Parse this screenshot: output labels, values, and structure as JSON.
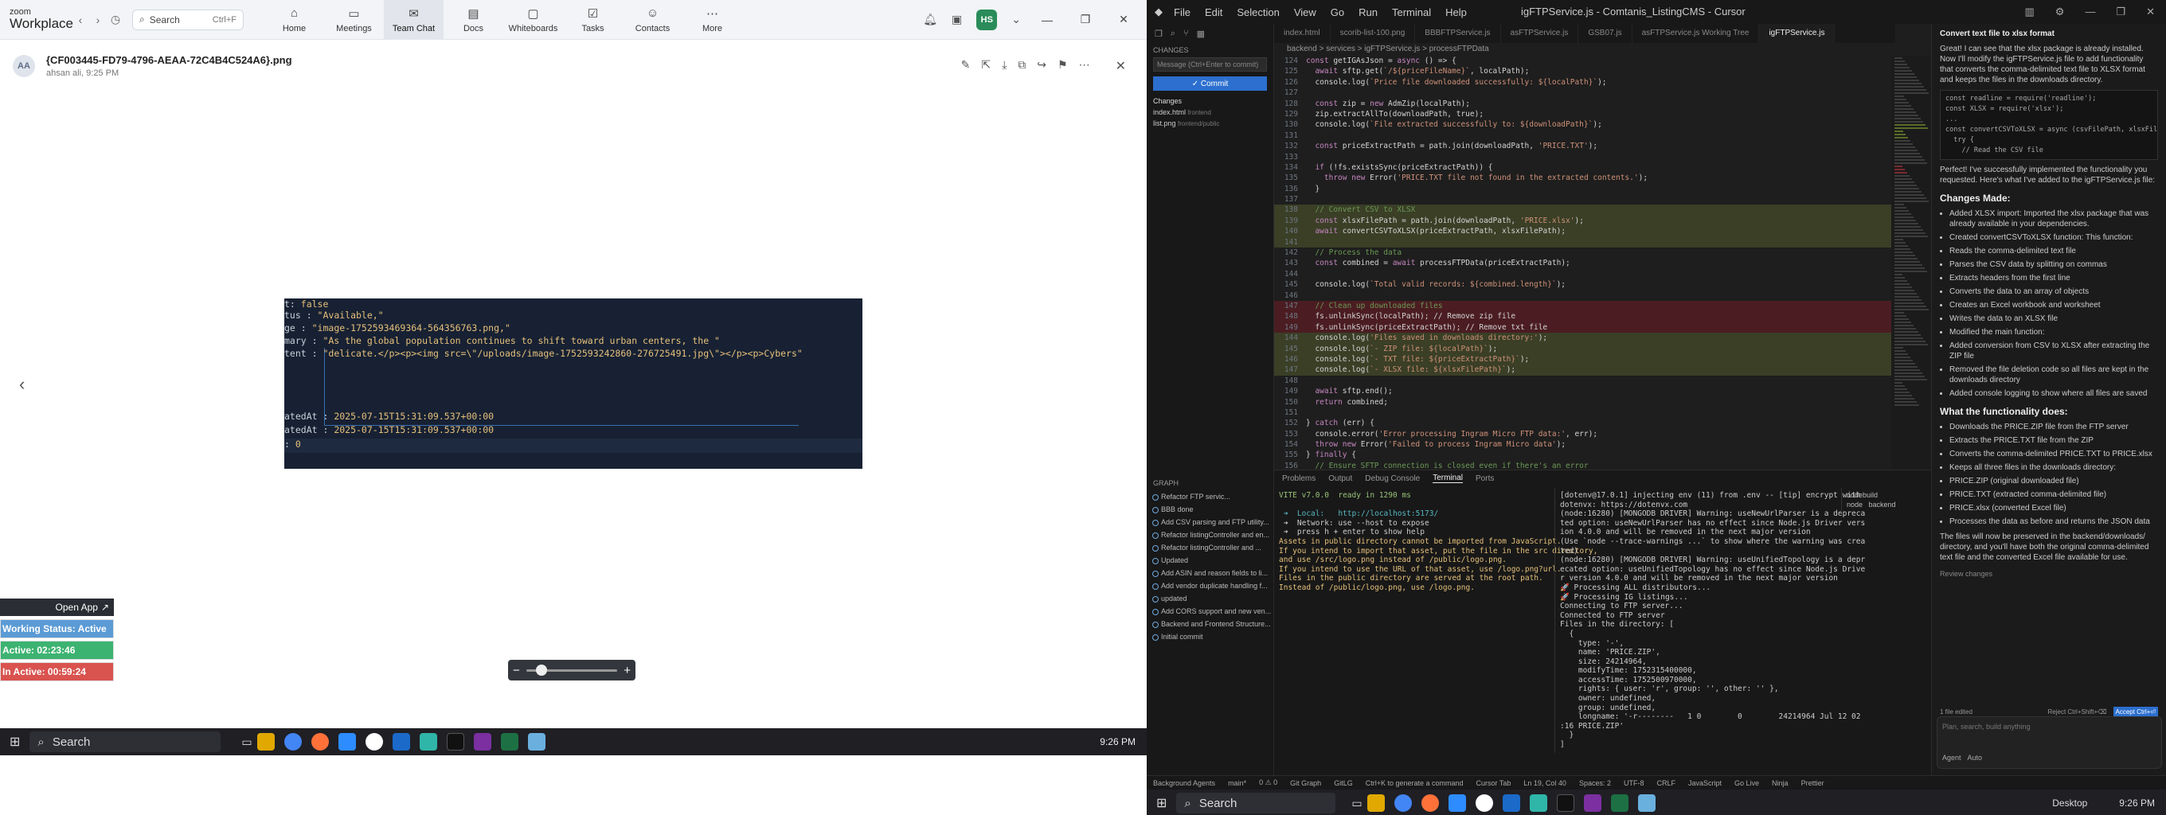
{
  "zoom": {
    "brand_line1": "zoom",
    "brand_line2": "Workplace",
    "search_placeholder": "Search",
    "search_shortcut": "Ctrl+F",
    "nav": [
      {
        "label": "Home",
        "icon": "home-icon",
        "glyph": "⌂"
      },
      {
        "label": "Meetings",
        "icon": "video-icon",
        "glyph": "▭"
      },
      {
        "label": "Team Chat",
        "icon": "chat-icon",
        "glyph": "✉"
      },
      {
        "label": "Docs",
        "icon": "doc-icon",
        "glyph": "▤"
      },
      {
        "label": "Whiteboards",
        "icon": "whiteboard-icon",
        "glyph": "▢"
      },
      {
        "label": "Tasks",
        "icon": "tasks-icon",
        "glyph": "☑"
      },
      {
        "label": "Contacts",
        "icon": "contacts-icon",
        "glyph": "☺"
      },
      {
        "label": "More",
        "icon": "more-icon",
        "glyph": "⋯"
      }
    ],
    "active_tab": "Team Chat",
    "user_initials": "HS",
    "viewer": {
      "avatar_initials": "AA",
      "file_name": "{CF003445-FD79-4796-AEAA-72C4B4C524A6}.png",
      "meta": "ahsan ali, 9:25 PM"
    },
    "screenshot_lines": [
      {
        "key": "t: ",
        "val": "false"
      },
      {
        "key": "tus : ",
        "val": "\"Available,\""
      },
      {
        "key": "ge : ",
        "val": "\"image-1752593469364-564356763.png,\""
      },
      {
        "key": "mary : ",
        "val": "\"As the global population continues to shift toward urban centers, the \""
      },
      {
        "key": "tent : ",
        "val": "\"delicate.</p><p><img src=\\\"/uploads/image-1752593242860-276725491.jpg\\\"></p><p>Cybers\""
      },
      {
        "key": "atedAt : ",
        "val": "2025-07-15T15:31:09.537+00:00"
      },
      {
        "key": "atedAt : ",
        "val": "2025-07-15T15:31:09.537+00:00"
      },
      {
        "key": ": ",
        "val": "0"
      }
    ],
    "open_app_label": "Open App",
    "status_rows": [
      {
        "text": "Working Status: Active",
        "color": "#5b9bd5"
      },
      {
        "text": "Active: 02:23:46",
        "color": "#3cb371"
      },
      {
        "text": "In Active: 00:59:24",
        "color": "#d9534f"
      }
    ]
  },
  "taskbar_left": {
    "search": "Search",
    "time": "9:26 PM"
  },
  "taskbar_right": {
    "search": "Search",
    "desktop": "Desktop",
    "time": "9:26 PM"
  },
  "cursor": {
    "menu": [
      "File",
      "Edit",
      "Selection",
      "View",
      "Go",
      "Run",
      "Terminal",
      "Help"
    ],
    "title": "igFTPService.js - Comtanis_ListingCMS - Cursor",
    "tabs": [
      "index.html",
      "scorib-list-100.png",
      "BBBFTPService.js",
      "asFTPService.js",
      "GSB07.js",
      "asFTPService.js Working Tree",
      "igFTPService.js"
    ],
    "breadcrumb": "backend > services > igFTPService.js > processFTPData",
    "sidebar": {
      "section": "CHANGES",
      "message_placeholder": "Message (Ctrl+Enter to commit)",
      "commit": "✓ Commit",
      "changes_label": "Changes",
      "files": [
        {
          "name": "index.html",
          "dir": "frontend"
        },
        {
          "name": "list.png",
          "dir": "frontend/public"
        }
      ],
      "graph_label": "GRAPH",
      "graph": [
        "Refactor FTP servic...",
        "BBB done",
        "Add CSV parsing and FTP utility...",
        "Refactor listingController and en...",
        "Refactor listingController and ...",
        "Updated",
        "Add ASIN and reason fields to li...",
        "Add vendor duplicate handling f...",
        "updated",
        "Add CORS support and new ven...",
        "Backend and Frontend Structure...",
        "Initial commit"
      ]
    },
    "code_lines": [
      {
        "n": "124",
        "t": "const getIGAsJson = async () => {",
        "c": ""
      },
      {
        "n": "125",
        "t": "  await sftp.get(`/${priceFileName}`, localPath);",
        "c": ""
      },
      {
        "n": "126",
        "t": "  console.log(`Price file downloaded successfully: ${localPath}`);",
        "c": ""
      },
      {
        "n": "127",
        "t": "",
        "c": ""
      },
      {
        "n": "128",
        "t": "  const zip = new AdmZip(localPath);",
        "c": ""
      },
      {
        "n": "129",
        "t": "  zip.extractAllTo(downloadPath, true);",
        "c": ""
      },
      {
        "n": "130",
        "t": "  console.log(`File extracted successfully to: ${downloadPath}`);",
        "c": ""
      },
      {
        "n": "131",
        "t": "",
        "c": ""
      },
      {
        "n": "132",
        "t": "  const priceExtractPath = path.join(downloadPath, 'PRICE.TXT');",
        "c": ""
      },
      {
        "n": "133",
        "t": "",
        "c": ""
      },
      {
        "n": "134",
        "t": "  if (!fs.existsSync(priceExtractPath)) {",
        "c": ""
      },
      {
        "n": "135",
        "t": "    throw new Error('PRICE.TXT file not found in the extracted contents.');",
        "c": ""
      },
      {
        "n": "136",
        "t": "  }",
        "c": ""
      },
      {
        "n": "137",
        "t": "",
        "c": ""
      },
      {
        "n": "138",
        "t": "  // Convert CSV to XLSX",
        "c": "add"
      },
      {
        "n": "139",
        "t": "  const xlsxFilePath = path.join(downloadPath, 'PRICE.xlsx');",
        "c": "add"
      },
      {
        "n": "140",
        "t": "  await convertCSVToXLSX(priceExtractPath, xlsxFilePath);",
        "c": "add"
      },
      {
        "n": "141",
        "t": "",
        "c": "add"
      },
      {
        "n": "142",
        "t": "  // Process the data",
        "c": ""
      },
      {
        "n": "143",
        "t": "  const combined = await processFTPData(priceExtractPath);",
        "c": ""
      },
      {
        "n": "144",
        "t": "",
        "c": ""
      },
      {
        "n": "145",
        "t": "  console.log(`Total valid records: ${combined.length}`);",
        "c": ""
      },
      {
        "n": "146",
        "t": "",
        "c": ""
      },
      {
        "n": "147",
        "t": "  // Clean up downloaded files",
        "c": "del"
      },
      {
        "n": "148",
        "t": "  fs.unlinkSync(localPath); // Remove zip file",
        "c": "del"
      },
      {
        "n": "149",
        "t": "  fs.unlinkSync(priceExtractPath); // Remove txt file",
        "c": "del"
      },
      {
        "n": "144",
        "t": "  console.log('Files saved in downloads directory:');",
        "c": "add"
      },
      {
        "n": "145",
        "t": "  console.log(`- ZIP file: ${localPath}`);",
        "c": "add"
      },
      {
        "n": "146",
        "t": "  console.log(`- TXT file: ${priceExtractPath}`);",
        "c": "add"
      },
      {
        "n": "147",
        "t": "  console.log(`- XLSX file: ${xlsxFilePath}`);",
        "c": "add"
      },
      {
        "n": "148",
        "t": "",
        "c": ""
      },
      {
        "n": "149",
        "t": "  await sftp.end();",
        "c": ""
      },
      {
        "n": "150",
        "t": "  return combined;",
        "c": ""
      },
      {
        "n": "151",
        "t": "",
        "c": ""
      },
      {
        "n": "152",
        "t": "} catch (err) {",
        "c": ""
      },
      {
        "n": "153",
        "t": "  console.error('Error processing Ingram Micro FTP data:', err);",
        "c": ""
      },
      {
        "n": "154",
        "t": "  throw new Error('Failed to process Ingram Micro data');",
        "c": ""
      },
      {
        "n": "155",
        "t": "} finally {",
        "c": ""
      },
      {
        "n": "156",
        "t": "  // Ensure SFTP connection is closed even if there's an error",
        "c": ""
      }
    ],
    "panel_tabs": [
      "Problems",
      "Output",
      "Debug Console",
      "Terminal",
      "Ports"
    ],
    "terminal_left": [
      {
        "t": "VITE v7.0.0  ready in 1290 ms",
        "c": "grn"
      },
      {
        "t": "",
        "c": ""
      },
      {
        "t": " ➜  Local:   http://localhost:5173/",
        "c": "cyan"
      },
      {
        "t": " ➜  Network: use --host to expose",
        "c": ""
      },
      {
        "t": " ➜  press h + enter to show help",
        "c": ""
      },
      {
        "t": "Assets in public directory cannot be imported from JavaScript.",
        "c": "yel"
      },
      {
        "t": "If you intend to import that asset, put the file in the src directory,",
        "c": "yel"
      },
      {
        "t": "and use /src/logo.png instead of /public/logo.png.",
        "c": "yel"
      },
      {
        "t": "If you intend to use the URL of that asset, use /logo.png?url.",
        "c": "yel"
      },
      {
        "t": "Files in the public directory are served at the root path.",
        "c": "yel"
      },
      {
        "t": "Instead of /public/logo.png, use /logo.png.",
        "c": "yel"
      }
    ],
    "terminal_right": [
      {
        "t": "[dotenv@17.0.1] injecting env (11) from .env -- [tip] encrypt with",
        "c": ""
      },
      {
        "t": "dotenvx: https://dotenvx.com",
        "c": ""
      },
      {
        "t": "(node:16280) [MONGODB DRIVER] Warning: useNewUrlParser is a depreca",
        "c": ""
      },
      {
        "t": "ted option: useNewUrlParser has no effect since Node.js Driver vers",
        "c": ""
      },
      {
        "t": "ion 4.0.0 and will be removed in the next major version",
        "c": ""
      },
      {
        "t": "(Use `node --trace-warnings ...` to show where the warning was crea",
        "c": ""
      },
      {
        "t": "ted)",
        "c": ""
      },
      {
        "t": "(node:16280) [MONGODB DRIVER] Warning: useUnifiedTopology is a depr",
        "c": ""
      },
      {
        "t": "ecated option: useUnifiedTopology has no effect since Node.js Drive",
        "c": ""
      },
      {
        "t": "r version 4.0.0 and will be removed in the next major version",
        "c": ""
      },
      {
        "t": "🚀 Processing ALL distributors...",
        "c": ""
      },
      {
        "t": "🚀 Processing IG listings...",
        "c": ""
      },
      {
        "t": "Connecting to FTP server...",
        "c": ""
      },
      {
        "t": "Connected to FTP server",
        "c": ""
      },
      {
        "t": "Files in the directory: [",
        "c": ""
      },
      {
        "t": "  {",
        "c": ""
      },
      {
        "t": "    type: '-',",
        "c": ""
      },
      {
        "t": "    name: 'PRICE.ZIP',",
        "c": ""
      },
      {
        "t": "    size: 24214964,",
        "c": ""
      },
      {
        "t": "    modifyTime: 1752315400000,",
        "c": ""
      },
      {
        "t": "    accessTime: 1752500970000,",
        "c": ""
      },
      {
        "t": "    rights: { user: 'r', group: '', other: '' },",
        "c": ""
      },
      {
        "t": "    owner: undefined,",
        "c": ""
      },
      {
        "t": "    group: undefined,",
        "c": ""
      },
      {
        "t": "    longname: '-r--------   1 0        0        24214964 Jul 12 02",
        "c": ""
      },
      {
        "t": ":16 PRICE.ZIP'",
        "c": ""
      },
      {
        "t": "  }",
        "c": ""
      },
      {
        "t": "]",
        "c": ""
      }
    ],
    "terminal_list": [
      "nodebuild",
      "node   backend"
    ],
    "statusbar": [
      "Background Agents",
      "main*",
      "0 ⚠ 0",
      "Git Graph",
      "GitLG",
      "Ctrl+K to generate a command",
      "Cursor Tab",
      "Ln 19, Col 40",
      "Spaces: 2",
      "UTF-8",
      "CRLF",
      "JavaScript",
      "Go Live",
      "Ninja",
      "Prettier"
    ],
    "chat": {
      "title": "Convert text file to xlsx format",
      "intro": "Great! I can see that the xlsx package is already installed. Now I'll modify the igFTPService.js file to add functionality that converts the comma-delimited text file to XLSX format and keeps the files in the downloads directory.",
      "codebox": "const readline = require('readline');\nconst XLSX = require('xlsx');\n...\nconst convertCSVToXLSX = async (csvFilePath, xlsxFilePath) =>\n  try {\n    // Read the CSV file",
      "perfect": "Perfect! I've successfully implemented the functionality you requested. Here's what I've added to the igFTPService.js file:",
      "changes_title": "Changes Made:",
      "changes": [
        "Added XLSX import: Imported the xlsx package that was already available in your dependencies.",
        "Created convertCSVToXLSX function: This function:",
        "Reads the comma-delimited text file",
        "Parses the CSV data by splitting on commas",
        "Extracts headers from the first line",
        "Converts the data to an array of objects",
        "Creates an Excel workbook and worksheet",
        "Writes the data to an XLSX file",
        "Modified the main function:",
        "Added conversion from CSV to XLSX after extracting the ZIP file",
        "Removed the file deletion code so all files are kept in the downloads directory",
        "Added console logging to show where all files are saved"
      ],
      "does_title": "What the functionality does:",
      "does": [
        "Downloads the PRICE.ZIP file from the FTP server",
        "Extracts the PRICE.TXT file from the ZIP",
        "Converts the comma-delimited PRICE.TXT to PRICE.xlsx",
        "Keeps all three files in the downloads directory:",
        "PRICE.ZIP (original downloaded file)",
        "PRICE.TXT (extracted comma-delimited file)",
        "PRICE.xlsx (converted Excel file)",
        "Processes the data as before and returns the JSON data"
      ],
      "outro": "The files will now be preserved in the backend/downloads/ directory, and you'll have both the original comma-delimited text file and the converted Excel file available for use.",
      "review": "Review changes",
      "files_edited": "1 file edited",
      "reject": "Reject Ctrl+Shift+⌫",
      "accept": "Accept Ctrl+⏎",
      "input_placeholder": "Plan, search, build anything",
      "agent_label": "Agent",
      "auto_label": "Auto"
    }
  }
}
